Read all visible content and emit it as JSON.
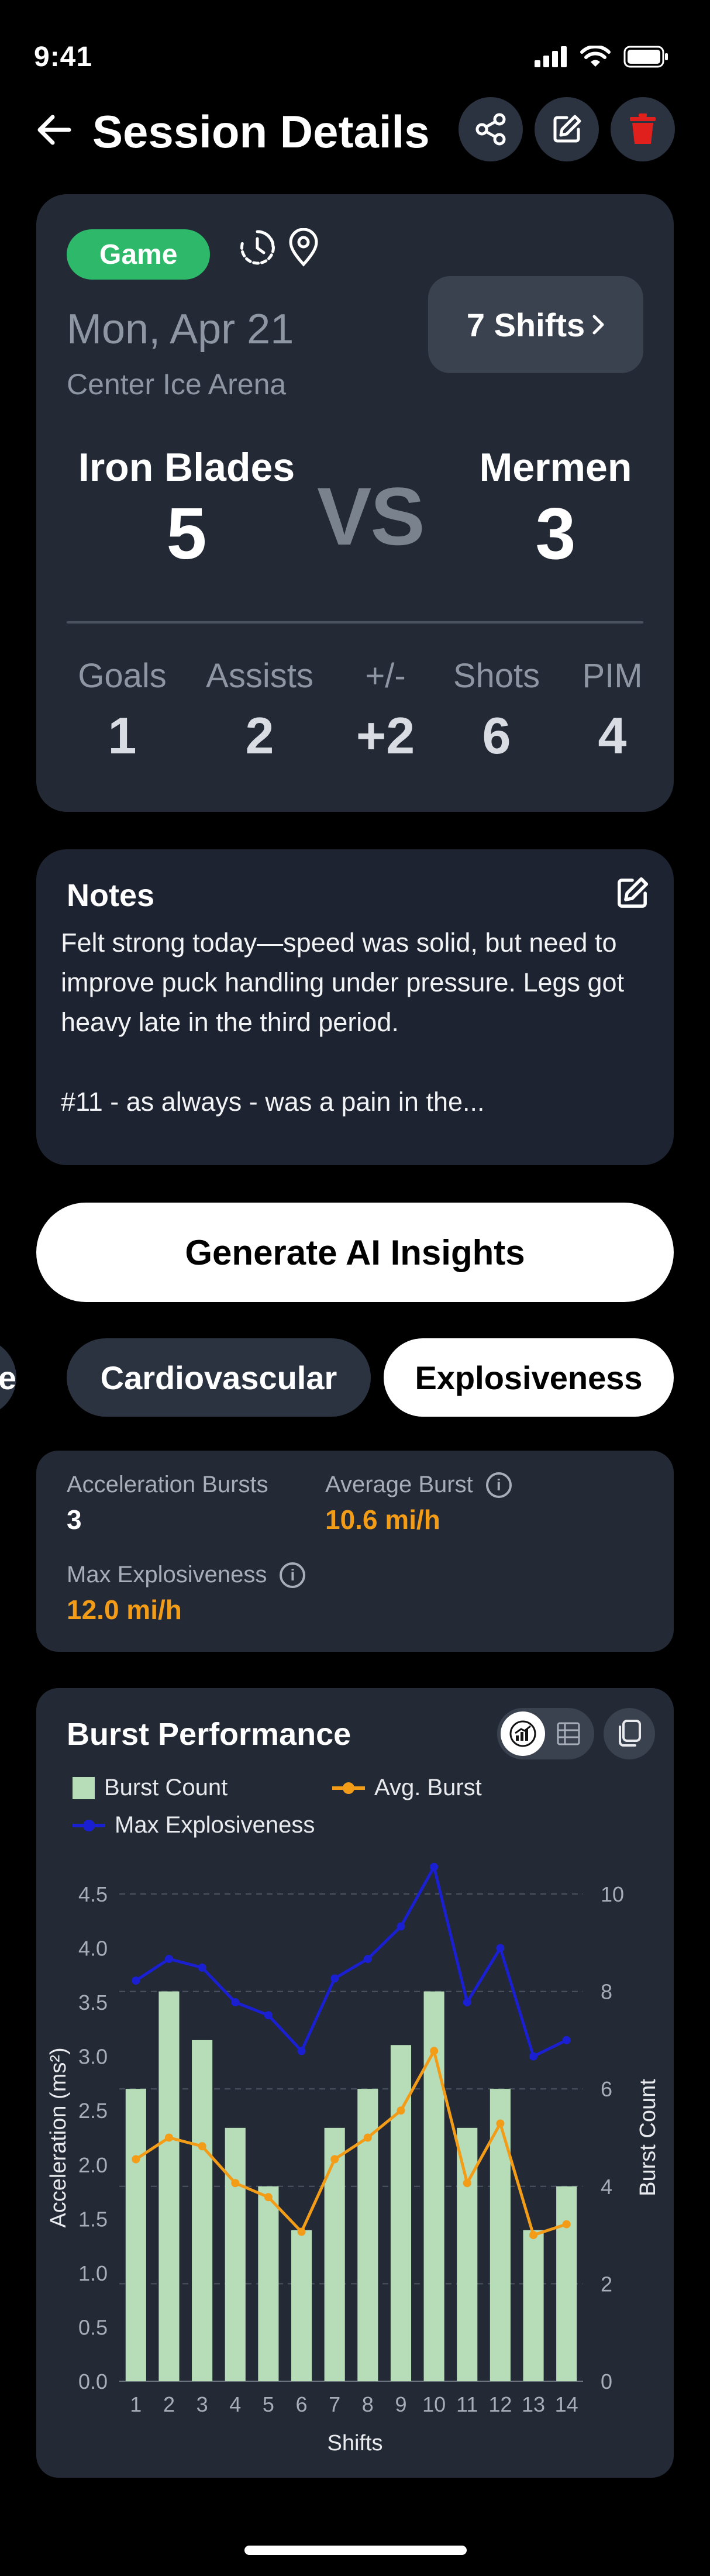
{
  "status_bar": {
    "time": "9:41"
  },
  "header": {
    "title": "Session Details"
  },
  "session": {
    "type_badge": "Game",
    "date": "Mon, Apr 21",
    "location": "Center Ice Arena",
    "shifts_button": "7 Shifts",
    "home_team": {
      "name": "Iron Blades",
      "score": "5"
    },
    "away_team": {
      "name": "Mermen",
      "score": "3"
    },
    "vs_label": "VS",
    "stats": [
      {
        "label": "Goals",
        "value": "1"
      },
      {
        "label": "Assists",
        "value": "2"
      },
      {
        "label": "+/-",
        "value": "+2"
      },
      {
        "label": "Shots",
        "value": "6"
      },
      {
        "label": "PIM",
        "value": "4"
      }
    ]
  },
  "notes": {
    "title": "Notes",
    "text": "Felt strong today—speed was solid, but need to improve puck handling under pressure. Legs got heavy late in the third period.\n\n#11 - as always - was a pain in the..."
  },
  "ai_button": "Generate AI Insights",
  "tabs": [
    {
      "label": "e",
      "active": false
    },
    {
      "label": "Cardiovascular",
      "active": false
    },
    {
      "label": "Explosiveness",
      "active": true
    }
  ],
  "metrics": {
    "acceleration_bursts": {
      "label": "Acceleration Bursts",
      "value": "3"
    },
    "average_burst": {
      "label": "Average Burst",
      "value": "10.6 mi/h"
    },
    "max_explosiveness": {
      "label": "Max Explosiveness",
      "value": "12.0 mi/h"
    }
  },
  "colors": {
    "accent_orange": "#f39c18",
    "badge_green": "#2db86a",
    "delete_red": "#e0201c",
    "bar_green": "#b6ddb8",
    "max_line_blue": "#1a1fd1"
  },
  "chart_data": {
    "type": "bar",
    "title": "Burst Performance",
    "xlabel": "Shifts",
    "ylabel": "Acceleration (ms²)",
    "y2label": "Burst Count",
    "x": [
      1,
      2,
      3,
      4,
      5,
      6,
      7,
      8,
      9,
      10,
      11,
      12,
      13,
      14
    ],
    "ylim": [
      0,
      4.5
    ],
    "y_ticks": [
      "0.0",
      "0.5",
      "1.0",
      "1.5",
      "2.0",
      "2.5",
      "3.0",
      "3.5",
      "4.0",
      "4.5"
    ],
    "y2lim": [
      0,
      10
    ],
    "y2_ticks": [
      "0",
      "2",
      "4",
      "6",
      "8",
      "10"
    ],
    "grid": true,
    "legend_placement": "top-left",
    "series": [
      {
        "name": "Burst Count",
        "type": "bar",
        "axis": "right",
        "color": "#b6ddb8",
        "values": [
          6,
          8,
          7,
          5.2,
          4,
          3.1,
          5.2,
          6,
          6.9,
          8,
          5.2,
          6,
          3.1,
          4
        ]
      },
      {
        "name": "Avg. Burst",
        "type": "line",
        "axis": "left",
        "color": "#f39c18",
        "values": [
          2.05,
          2.25,
          2.17,
          1.83,
          1.7,
          1.38,
          2.05,
          2.25,
          2.5,
          3.05,
          1.83,
          2.38,
          1.35,
          1.45
        ]
      },
      {
        "name": "Max Explosiveness",
        "type": "line",
        "axis": "left",
        "color": "#1a1fd1",
        "values": [
          3.7,
          3.9,
          3.82,
          3.5,
          3.38,
          3.05,
          3.72,
          3.9,
          4.2,
          4.75,
          3.5,
          4.0,
          3.0,
          3.15
        ]
      }
    ]
  }
}
